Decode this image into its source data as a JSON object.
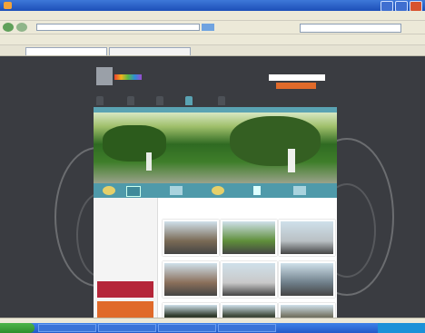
{
  "window": {
    "title": "",
    "controls": [
      "minimize-button",
      "maximize-button",
      "close-button"
    ]
  },
  "menubar": {
    "items": []
  },
  "navigation": {
    "address": "",
    "search_placeholder": ""
  },
  "links_bar": {
    "items": []
  },
  "tabs": [
    {
      "label": ""
    },
    {
      "label": ""
    }
  ],
  "site": {
    "nav_items": [
      {
        "label": ""
      },
      {
        "label": ""
      },
      {
        "label": ""
      },
      {
        "label": ""
      },
      {
        "label": ""
      }
    ],
    "active_nav_index": 3,
    "main_title": "",
    "main_subtitle": "",
    "sidebar_title": "",
    "promo1": "",
    "promo2": "",
    "thumb_colors": [
      "#7a6a55",
      "#5f8f3a",
      "#b9c0c4",
      "#8a6f5a",
      "#c9c9c9",
      "#6f7f8a",
      "#2f3a2a",
      "#3f4a3a",
      "#7a7a6a"
    ]
  },
  "taskbar": {
    "start_label": "",
    "tasks": [
      {
        "label": ""
      },
      {
        "label": ""
      },
      {
        "label": ""
      },
      {
        "label": ""
      }
    ],
    "clock": ""
  },
  "colors": {
    "accent": "#5aa3b3",
    "titlebar": "#1d4fb8",
    "page_bg": "#3a3c41",
    "brand_orange": "#e06a2a",
    "brand_red": "#b5263a"
  }
}
